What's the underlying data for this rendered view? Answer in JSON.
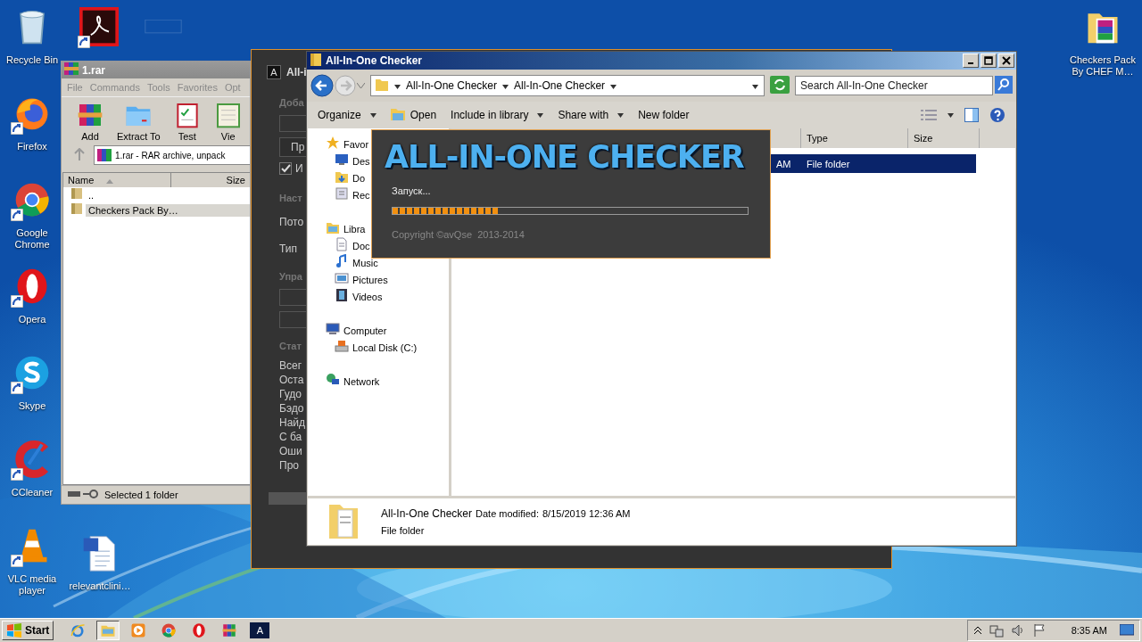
{
  "desktop_icons_left": [
    {
      "label": "Recycle Bin",
      "kind": "recycle",
      "shortcut": false
    },
    {
      "label": "Firefox",
      "kind": "firefox",
      "shortcut": true
    },
    {
      "label": "Google Chrome",
      "kind": "chrome",
      "shortcut": true
    },
    {
      "label": "Opera",
      "kind": "opera",
      "shortcut": true
    },
    {
      "label": "Skype",
      "kind": "skype",
      "shortcut": true
    },
    {
      "label": "CCleaner",
      "kind": "ccleaner",
      "shortcut": true
    },
    {
      "label": "VLC media player",
      "kind": "vlc",
      "shortcut": true
    }
  ],
  "desktop_icons_top": [
    {
      "kind": "acrobat",
      "shortcut": true
    },
    {
      "kind": "blank",
      "shortcut": false
    }
  ],
  "desktop_icons_bottom": [
    {
      "label": "relevantclini…",
      "kind": "word",
      "shortcut": false
    }
  ],
  "desktop_icons_right": [
    {
      "label": "Checkers Pack By CHEF M…",
      "kind": "rarfolder",
      "shortcut": false
    }
  ],
  "winrar": {
    "title": "1.rar",
    "menu": [
      "File",
      "Commands",
      "Tools",
      "Favorites",
      "Opt"
    ],
    "tools": [
      {
        "label": "Add",
        "kind": "rar"
      },
      {
        "label": "Extract To",
        "kind": "folder"
      },
      {
        "label": "Test",
        "kind": "test"
      },
      {
        "label": "Vie",
        "kind": "book"
      }
    ],
    "address": "1.rar - RAR archive, unpack",
    "columns": [
      "Name",
      "Size"
    ],
    "rows": [
      {
        "name": "..",
        "selected": false
      },
      {
        "name": "Checkers Pack By…",
        "selected": true
      }
    ],
    "status": "Selected 1 folder"
  },
  "checker_window": {
    "icon_letter": "A",
    "title": "All-i",
    "items": [
      {
        "kind": "group",
        "text": "Доба"
      },
      {
        "kind": "field"
      },
      {
        "kind": "button",
        "text": "Пр"
      },
      {
        "kind": "checkbox",
        "text": "И",
        "checked": true
      },
      {
        "kind": "group",
        "text": "Наст"
      },
      {
        "kind": "label",
        "text": "Пото"
      },
      {
        "kind": "label",
        "text": "Тип"
      },
      {
        "kind": "group",
        "text": "Упра"
      },
      {
        "kind": "field"
      },
      {
        "kind": "field"
      },
      {
        "kind": "group",
        "text": "Стат"
      },
      {
        "kind": "stat",
        "text": "Всег"
      },
      {
        "kind": "stat",
        "text": "Оста"
      },
      {
        "kind": "stat",
        "text": "Гудо"
      },
      {
        "kind": "stat",
        "text": "Бэдо"
      },
      {
        "kind": "stat",
        "text": "Найд"
      },
      {
        "kind": "stat",
        "text": "С ба"
      },
      {
        "kind": "stat",
        "text": "Оши"
      },
      {
        "kind": "stat",
        "text": "Про"
      },
      {
        "kind": "bar"
      }
    ]
  },
  "explorer": {
    "title": "All-In-One Checker",
    "breadcrumb": [
      "All-In-One Checker",
      "All-In-One Checker"
    ],
    "search": {
      "placeholder": "Search All-In-One Checker"
    },
    "toolbar": [
      {
        "label": "Organize",
        "kind": "menu"
      },
      {
        "label": "Open",
        "kind": "open"
      },
      {
        "label": "Include in library",
        "kind": "menu"
      },
      {
        "label": "Share with",
        "kind": "menu"
      },
      {
        "label": "New folder",
        "kind": "plain"
      }
    ],
    "nav": [
      {
        "label": "Favor",
        "kind": "star",
        "children": [
          {
            "label": "Des",
            "kind": "desktop"
          },
          {
            "label": "Do",
            "kind": "downloads"
          },
          {
            "label": "Rec",
            "kind": "recent"
          }
        ]
      },
      {
        "label": "Libra",
        "kind": "library",
        "children": [
          {
            "label": "Doc",
            "kind": "doc"
          },
          {
            "label": "Music",
            "kind": "music"
          },
          {
            "label": "Pictures",
            "kind": "pictures"
          },
          {
            "label": "Videos",
            "kind": "videos"
          }
        ]
      },
      {
        "label": "Computer",
        "kind": "computer",
        "children": [
          {
            "label": "Local Disk (C:)",
            "kind": "disk"
          }
        ]
      },
      {
        "label": "Network",
        "kind": "network"
      }
    ],
    "columns": [
      "Type",
      "Size"
    ],
    "rows": [
      {
        "date": "AM",
        "type": "File folder",
        "selected": true
      }
    ],
    "details": {
      "name": "All-In-One Checker",
      "date_label": "Date modified:",
      "date": "8/15/2019 12:36 AM",
      "type": "File folder"
    }
  },
  "splash": {
    "title": "ALL-IN-ONE CHECKER",
    "status": "Запуск...",
    "level": 0.3,
    "copyright": "Copyright ©avQse  2013-2014"
  },
  "taskbar": {
    "start": "Start",
    "apps": [
      {
        "kind": "ie",
        "active": false
      },
      {
        "kind": "explorer",
        "active": true
      },
      {
        "kind": "media",
        "active": false
      },
      {
        "kind": "chrome",
        "active": false
      },
      {
        "kind": "opera",
        "active": false
      },
      {
        "kind": "rar",
        "active": false
      },
      {
        "kind": "checker",
        "active": false,
        "letter": "A"
      }
    ],
    "clock": "8:35 AM"
  }
}
